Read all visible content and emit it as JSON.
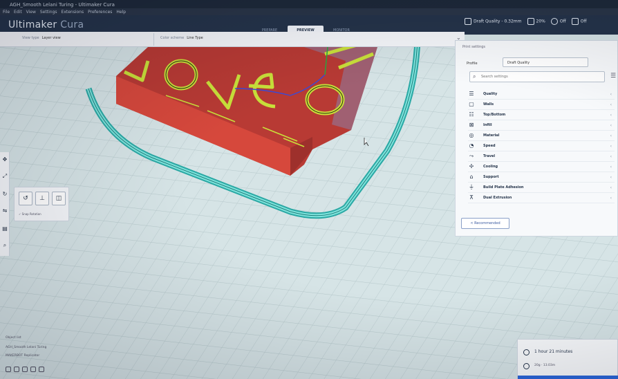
{
  "window": {
    "title": "AGH_Smooth Lelani Turing - Ultimaker Cura",
    "menu": [
      "File",
      "Edit",
      "View",
      "Settings",
      "Extensions",
      "Preferences",
      "Help"
    ]
  },
  "header": {
    "logo_main": "Ultimaker",
    "logo_sub": "Cura",
    "tabs": [
      "PREPARE",
      "PREVIEW",
      "MONITOR"
    ],
    "active_tab": "PREVIEW",
    "quality": "Draft Quality - 0.32mm",
    "infill": "20%",
    "support": "Off",
    "adhesion": "Off"
  },
  "viewbar": {
    "view_type_label": "View type",
    "view_type_value": "Layer view",
    "color_scheme_label": "Color scheme",
    "color_scheme_value": "Line Type"
  },
  "rotate_panel": {
    "snap_label": "Snap Rotation"
  },
  "print_settings": {
    "title": "Print settings",
    "profile_label": "Profile",
    "profile_value": "Draft Quality",
    "search_placeholder": "Search settings",
    "categories": [
      {
        "label": "Quality",
        "icon": "quality-icon"
      },
      {
        "label": "Walls",
        "icon": "walls-icon"
      },
      {
        "label": "Top/Bottom",
        "icon": "top-bottom-icon"
      },
      {
        "label": "Infill",
        "icon": "infill-icon"
      },
      {
        "label": "Material",
        "icon": "material-icon"
      },
      {
        "label": "Speed",
        "icon": "speed-icon"
      },
      {
        "label": "Travel",
        "icon": "travel-icon"
      },
      {
        "label": "Cooling",
        "icon": "cooling-icon"
      },
      {
        "label": "Support",
        "icon": "support-icon"
      },
      {
        "label": "Build Plate Adhesion",
        "icon": "build-plate-adhesion-icon"
      },
      {
        "label": "Dual Extrusion",
        "icon": "dual-extrusion-icon"
      }
    ],
    "recommended_label": "< Recommended"
  },
  "estimate": {
    "time": "1 hour 21 minutes",
    "material": "20g · 13.03m"
  },
  "object_list": {
    "header": "Object list",
    "item": "AGH_Smooth Lelani Turing",
    "footer": "MAKERBOT Replicator"
  },
  "colors": {
    "header": "#25344a",
    "plate": "#d6e4e6",
    "model_wall": "#d9463a",
    "infill": "#c9e03a",
    "skirt": "#3cc6c0",
    "accent": "#2a66d8"
  }
}
